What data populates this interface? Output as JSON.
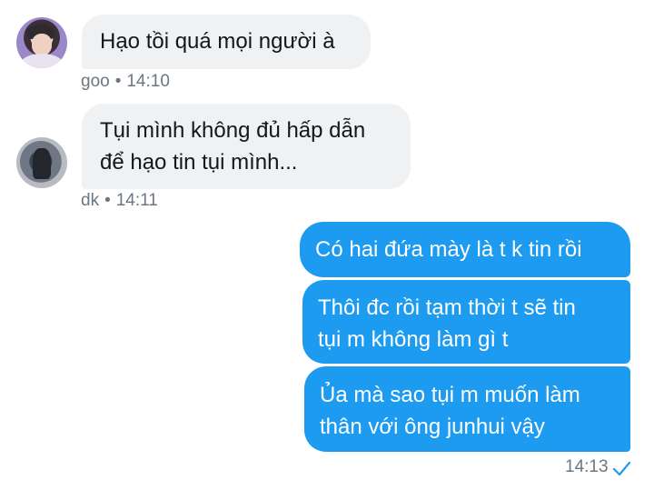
{
  "conversation": {
    "incoming": [
      {
        "sender": "goo",
        "time": "14:10",
        "lines": [
          "Hạo tồi quá mọi người à"
        ]
      },
      {
        "sender": "dk",
        "time": "14:11",
        "lines": [
          "Tụi mình không đủ hấp dẫn",
          "để hạo tin tụi mình..."
        ]
      }
    ],
    "outgoing": [
      {
        "lines": [
          "Có hai đứa mày là t k tin rồi"
        ]
      },
      {
        "lines": [
          "Thôi đc rồi tạm thời t sẽ tin",
          "tụi m không làm gì t"
        ]
      },
      {
        "lines": [
          "Ủa mà sao tụi m muốn làm",
          "thân với ông junhui vậy"
        ]
      }
    ],
    "outgoing_time": "14:13",
    "separator": "•"
  },
  "colors": {
    "incoming_bubble": "#eff1f3",
    "outgoing_bubble": "#1d9bf0",
    "read_check": "#1d9bf0"
  },
  "icons": {
    "read_receipt": "check-icon"
  }
}
